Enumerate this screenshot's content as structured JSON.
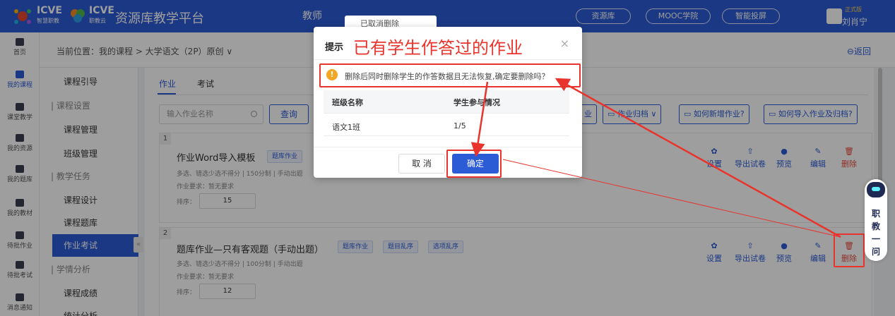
{
  "header": {
    "logo1_text": "ICVE",
    "logo1_sub": "智慧职教",
    "logo2_text": "ICVE",
    "logo2_sub": "职教云",
    "platform_title": "资源库教学平台",
    "teach_tab": "教师",
    "toast_text": "已取消删除",
    "nav": [
      "资源库",
      "MOOC学院",
      "智能投屏"
    ],
    "vip_badge": "正式版",
    "username": "刘肖宁"
  },
  "rail": [
    {
      "label": "首页",
      "icon": "home-icon"
    },
    {
      "label": "我的课程",
      "icon": "course-icon",
      "active": true
    },
    {
      "label": "课堂教学",
      "icon": "classroom-icon"
    },
    {
      "label": "我的资源",
      "icon": "resource-icon"
    },
    {
      "label": "我的题库",
      "icon": "question-bank-icon"
    },
    {
      "label": "我的教材",
      "icon": "textbook-icon"
    },
    {
      "label": "待批作业",
      "icon": "homework-icon"
    },
    {
      "label": "待批考试",
      "icon": "exam-icon"
    },
    {
      "label": "消息通知",
      "icon": "message-icon"
    }
  ],
  "breadcrumb": {
    "text": "当前位置：我的课程 > 大学语文（2P）原创 ∨",
    "back": "返回"
  },
  "sidemenu": [
    {
      "type": "item",
      "label": "课程引导"
    },
    {
      "type": "group",
      "label": "| 课程设置"
    },
    {
      "type": "item",
      "label": "课程管理"
    },
    {
      "type": "item",
      "label": "班级管理"
    },
    {
      "type": "group",
      "label": "| 教学任务"
    },
    {
      "type": "item",
      "label": "课程设计"
    },
    {
      "type": "item",
      "label": "课程题库"
    },
    {
      "type": "item",
      "label": "作业考试",
      "active": true
    },
    {
      "type": "group",
      "label": "| 学情分析"
    },
    {
      "type": "item",
      "label": "课程成绩"
    },
    {
      "type": "item",
      "label": "统计分析"
    }
  ],
  "main": {
    "tabs": [
      "作业",
      "考试"
    ],
    "search_placeholder": "输入作业名称",
    "query_label": "查询",
    "tool_buttons": [
      "业",
      "作业归档 ∨",
      "如何新增作业?",
      "如何导入作业及归档?"
    ],
    "cards": [
      {
        "num": "1",
        "title": "作业Word导入模板",
        "tags": [
          "题库作业"
        ],
        "meta": "多选、错选少选不得分 | 150分制 | 手动出题",
        "req": "作业要求：暂无要求",
        "sort_label": "排序：",
        "sort": "15"
      },
      {
        "num": "2",
        "title": "题库作业—只有客观题（手动出题）",
        "tags": [
          "题库作业",
          "题目乱序",
          "选项乱序"
        ],
        "meta": "多选、错选少选不得分 | 100分制 | 手动出题",
        "req": "作业要求：暂无要求",
        "sort_label": "排序：",
        "sort": "12"
      }
    ],
    "actions": [
      "设置",
      "导出试卷",
      "预览",
      "编辑",
      "删除"
    ]
  },
  "modal": {
    "title": "提示",
    "annotation": "已有学生作答过的作业",
    "warning": "删除后同时删除学生的作答数据且无法恢复,确定要删除吗？",
    "columns": [
      "班级名称",
      "学生参与情况"
    ],
    "rows": [
      [
        "语文1班",
        "1/5"
      ]
    ],
    "cancel": "取 消",
    "ok": "确定"
  },
  "assistant": [
    "职",
    "教",
    "一",
    "问"
  ],
  "colors": {
    "brand": "#2c5bd6",
    "danger": "#e84b3c",
    "annotation": "#e8342c",
    "warning": "#f5a623"
  }
}
